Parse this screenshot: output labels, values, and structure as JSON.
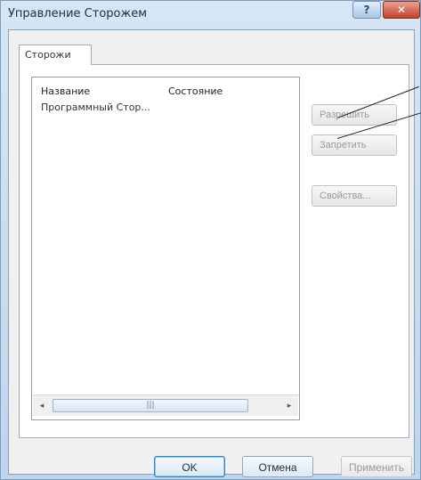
{
  "window": {
    "title": "Управление Сторожем",
    "help_icon": "?",
    "close_icon": "✕"
  },
  "tabs": [
    {
      "label": "Сторожи"
    }
  ],
  "list": {
    "columns": [
      "Название",
      "Состояние"
    ],
    "rows": [
      {
        "name": "Программный Стор...",
        "state": ""
      }
    ],
    "scrollbar": {
      "left_arrow": "◂",
      "right_arrow": "▸",
      "thumb_grip": "|||"
    }
  },
  "side_buttons": {
    "allow": "Разрешить",
    "deny": "Запретить",
    "properties": "Свойства..."
  },
  "bottom_buttons": {
    "ok": "OK",
    "cancel": "Отмена",
    "apply": "Применить"
  }
}
